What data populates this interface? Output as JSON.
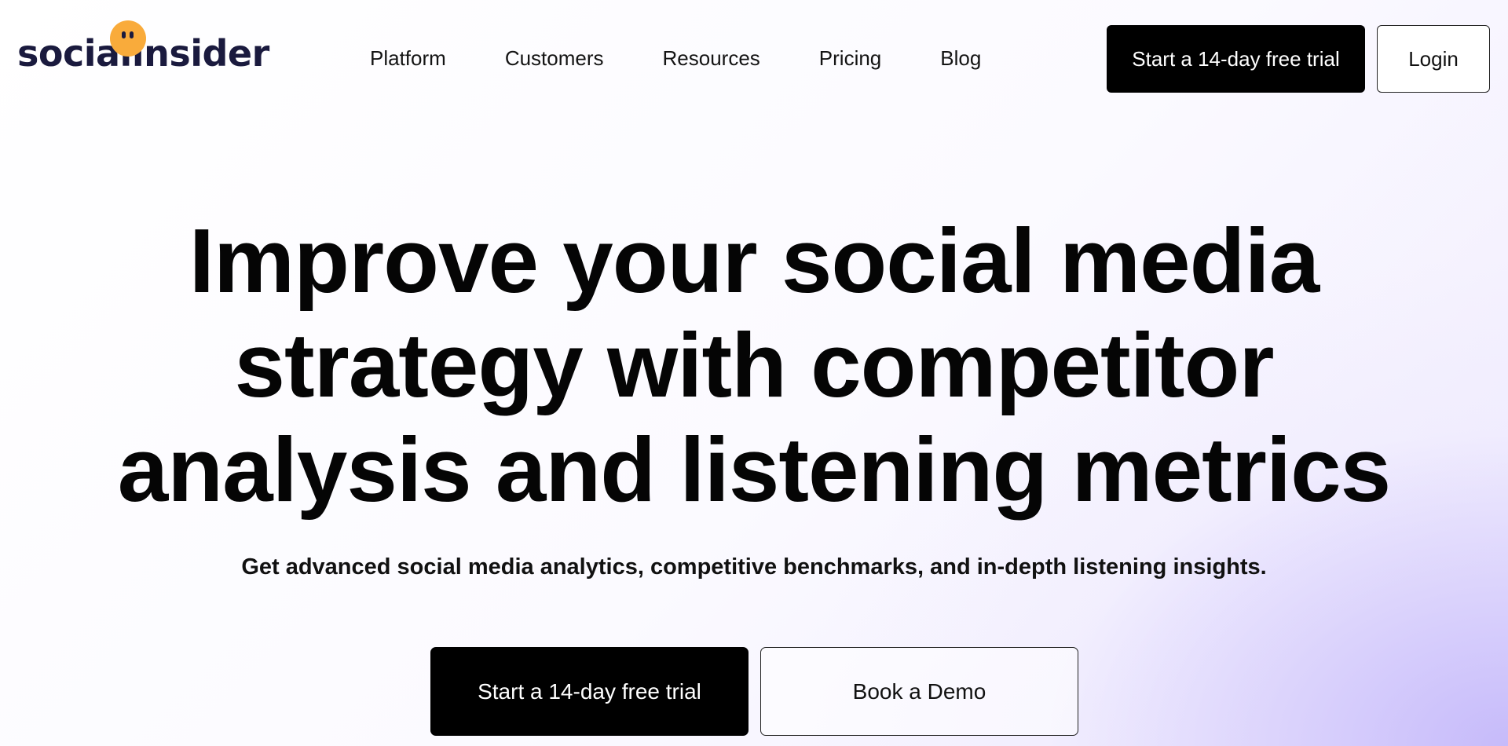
{
  "header": {
    "logo_text": "socialinsider",
    "nav": [
      {
        "label": "Platform"
      },
      {
        "label": "Customers"
      },
      {
        "label": "Resources"
      },
      {
        "label": "Pricing"
      },
      {
        "label": "Blog"
      }
    ],
    "cta_label": "Start a 14-day free trial",
    "login_label": "Login"
  },
  "hero": {
    "title_lines": [
      "Improve your social media",
      "strategy with competitor",
      "analysis and listening metrics"
    ],
    "subtitle": "Get advanced social media analytics, competitive benchmarks, and in-depth listening insights.",
    "primary_cta": "Start a 14-day free trial",
    "secondary_cta": "Book a Demo"
  },
  "colors": {
    "logo_accent": "#f9ab3b",
    "logo_text": "#1a1a3e",
    "primary_button": "#000000",
    "gradient_accent": "#c4b8fa"
  }
}
